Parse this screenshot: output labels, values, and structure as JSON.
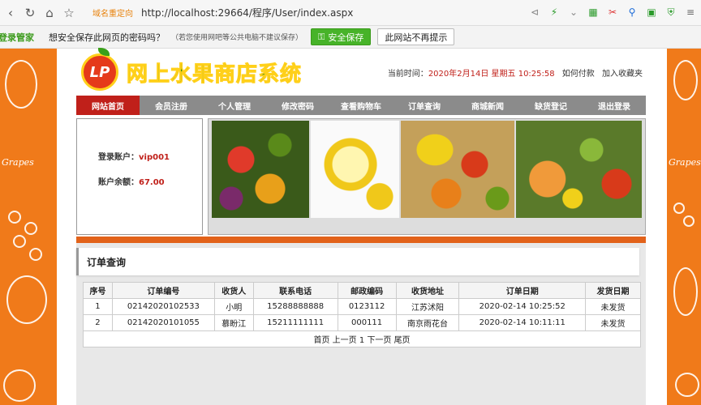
{
  "browser": {
    "redirect_label": "域名重定向",
    "url": "http://localhost:29664/程序/User/index.aspx"
  },
  "pw_bar": {
    "brand": "登录管家",
    "question": "想安全保存此网页的密码吗？",
    "note": "（若您使用网吧等公共电脑不建议保存）",
    "save_label": "安全保存",
    "never_label": "此网站不再提示"
  },
  "side": {
    "caption": "Grapes"
  },
  "header": {
    "title": "网上水果商店系统",
    "logo_text": "LP",
    "time_prefix": "当前时间：",
    "date": "2020年2月14日 星期五 10:25:58",
    "pay_link": "如何付款",
    "fav_link": "加入收藏夹"
  },
  "menu": [
    {
      "label": "网站首页"
    },
    {
      "label": "会员注册"
    },
    {
      "label": "个人管理"
    },
    {
      "label": "修改密码"
    },
    {
      "label": "查看购物车"
    },
    {
      "label": "订单查询"
    },
    {
      "label": "商城新闻"
    },
    {
      "label": "缺货登记"
    },
    {
      "label": "退出登录"
    }
  ],
  "account": {
    "user_label": "登录账户：",
    "user_value": "vip001",
    "balance_label": "账户余额：",
    "balance_value": "67.00"
  },
  "section": {
    "title": "订单查询"
  },
  "orders": {
    "headers": [
      "序号",
      "订单编号",
      "收货人",
      "联系电话",
      "邮政编码",
      "收货地址",
      "订单日期",
      "发货日期"
    ],
    "rows": [
      [
        "1",
        "02142020102533",
        "小明",
        "15288888888",
        "0123112",
        "江苏沭阳",
        "2020-02-14 10:25:52",
        "未发货"
      ],
      [
        "2",
        "02142020101055",
        "慕盼江",
        "15211111111",
        "000111",
        "南京雨花台",
        "2020-02-14 10:11:11",
        "未发货"
      ]
    ],
    "pager": {
      "first": "首页",
      "prev": "上一页",
      "page": "1",
      "next": "下一页",
      "last": "尾页"
    }
  }
}
